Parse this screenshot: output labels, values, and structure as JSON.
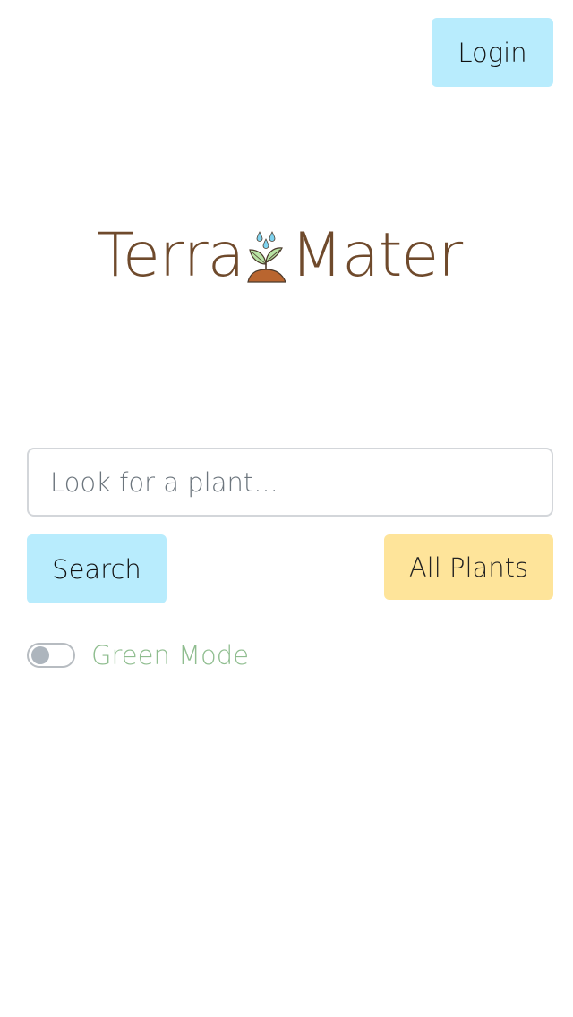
{
  "header": {
    "login_label": "Login"
  },
  "logo": {
    "text_left": "Terra",
    "text_right": "Mater",
    "icon": "sprout-with-water-drops-icon"
  },
  "search": {
    "placeholder": "Look for a plant...",
    "value": "",
    "search_label": "Search",
    "all_plants_label": "All Plants"
  },
  "settings": {
    "green_mode_label": "Green Mode",
    "green_mode_enabled": false
  },
  "colors": {
    "login_button_bg": "#b8ecfd",
    "search_button_bg": "#b8ecfd",
    "all_plants_button_bg": "#fee49a",
    "logo_text": "#6f4a2c",
    "green_mode_label": "#8fbd8f"
  }
}
